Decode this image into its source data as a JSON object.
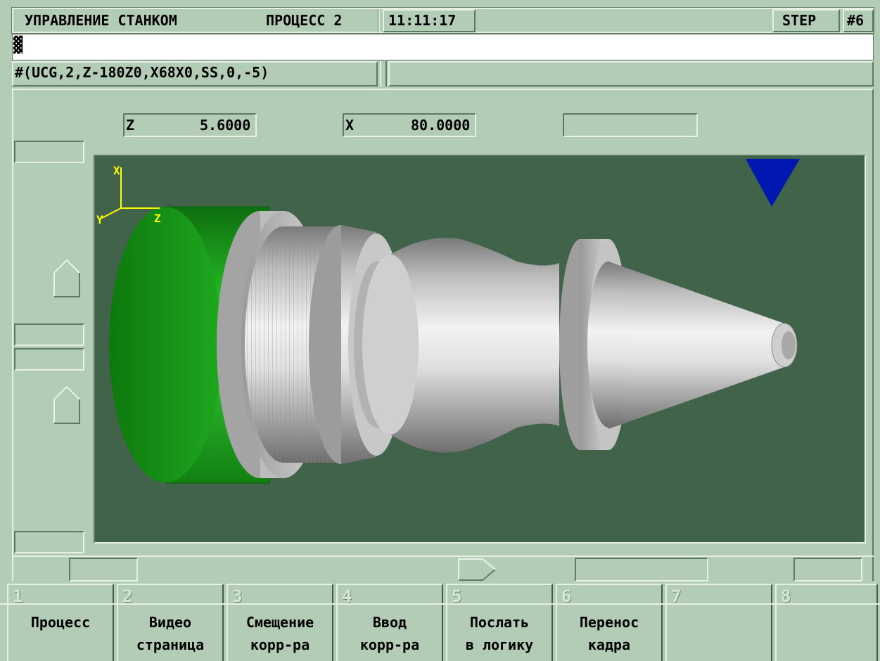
{
  "header": {
    "title": "УПРАВЛЕНИЕ СТАНКОМ",
    "process": "ПРОЦЕСС 2",
    "time": "11:11:17",
    "mode": "STEP",
    "channel": "#6"
  },
  "command_line": {
    "cursor": "▓",
    "value": ""
  },
  "program_line": {
    "text": "#(UCG,2,Z-180Z0,X68X0,SS,0,-5)"
  },
  "coordinates": {
    "z_label": "Z",
    "z_value": "5.6000",
    "x_label": "X",
    "x_value": "80.0000"
  },
  "viewport": {
    "background": "#40634a",
    "axes": {
      "x": "X",
      "y": "Y",
      "z": "Z",
      "color": "#ffff00"
    },
    "chuck_color": "#1fa61f",
    "part_color": "#d8d8d8",
    "tool_marker_color": "#0018b0"
  },
  "softkeys": [
    {
      "num": "1",
      "line1": "Процесс",
      "line2": ""
    },
    {
      "num": "2",
      "line1": "Видео",
      "line2": "страница"
    },
    {
      "num": "3",
      "line1": "Смещение",
      "line2": "корр-ра"
    },
    {
      "num": "4",
      "line1": "Ввод",
      "line2": "корр-ра"
    },
    {
      "num": "5",
      "line1": "Послать",
      "line2": "в логику"
    },
    {
      "num": "6",
      "line1": "Перенос",
      "line2": "кадра"
    },
    {
      "num": "7",
      "line1": "",
      "line2": ""
    },
    {
      "num": "8",
      "line1": "",
      "line2": ""
    }
  ]
}
